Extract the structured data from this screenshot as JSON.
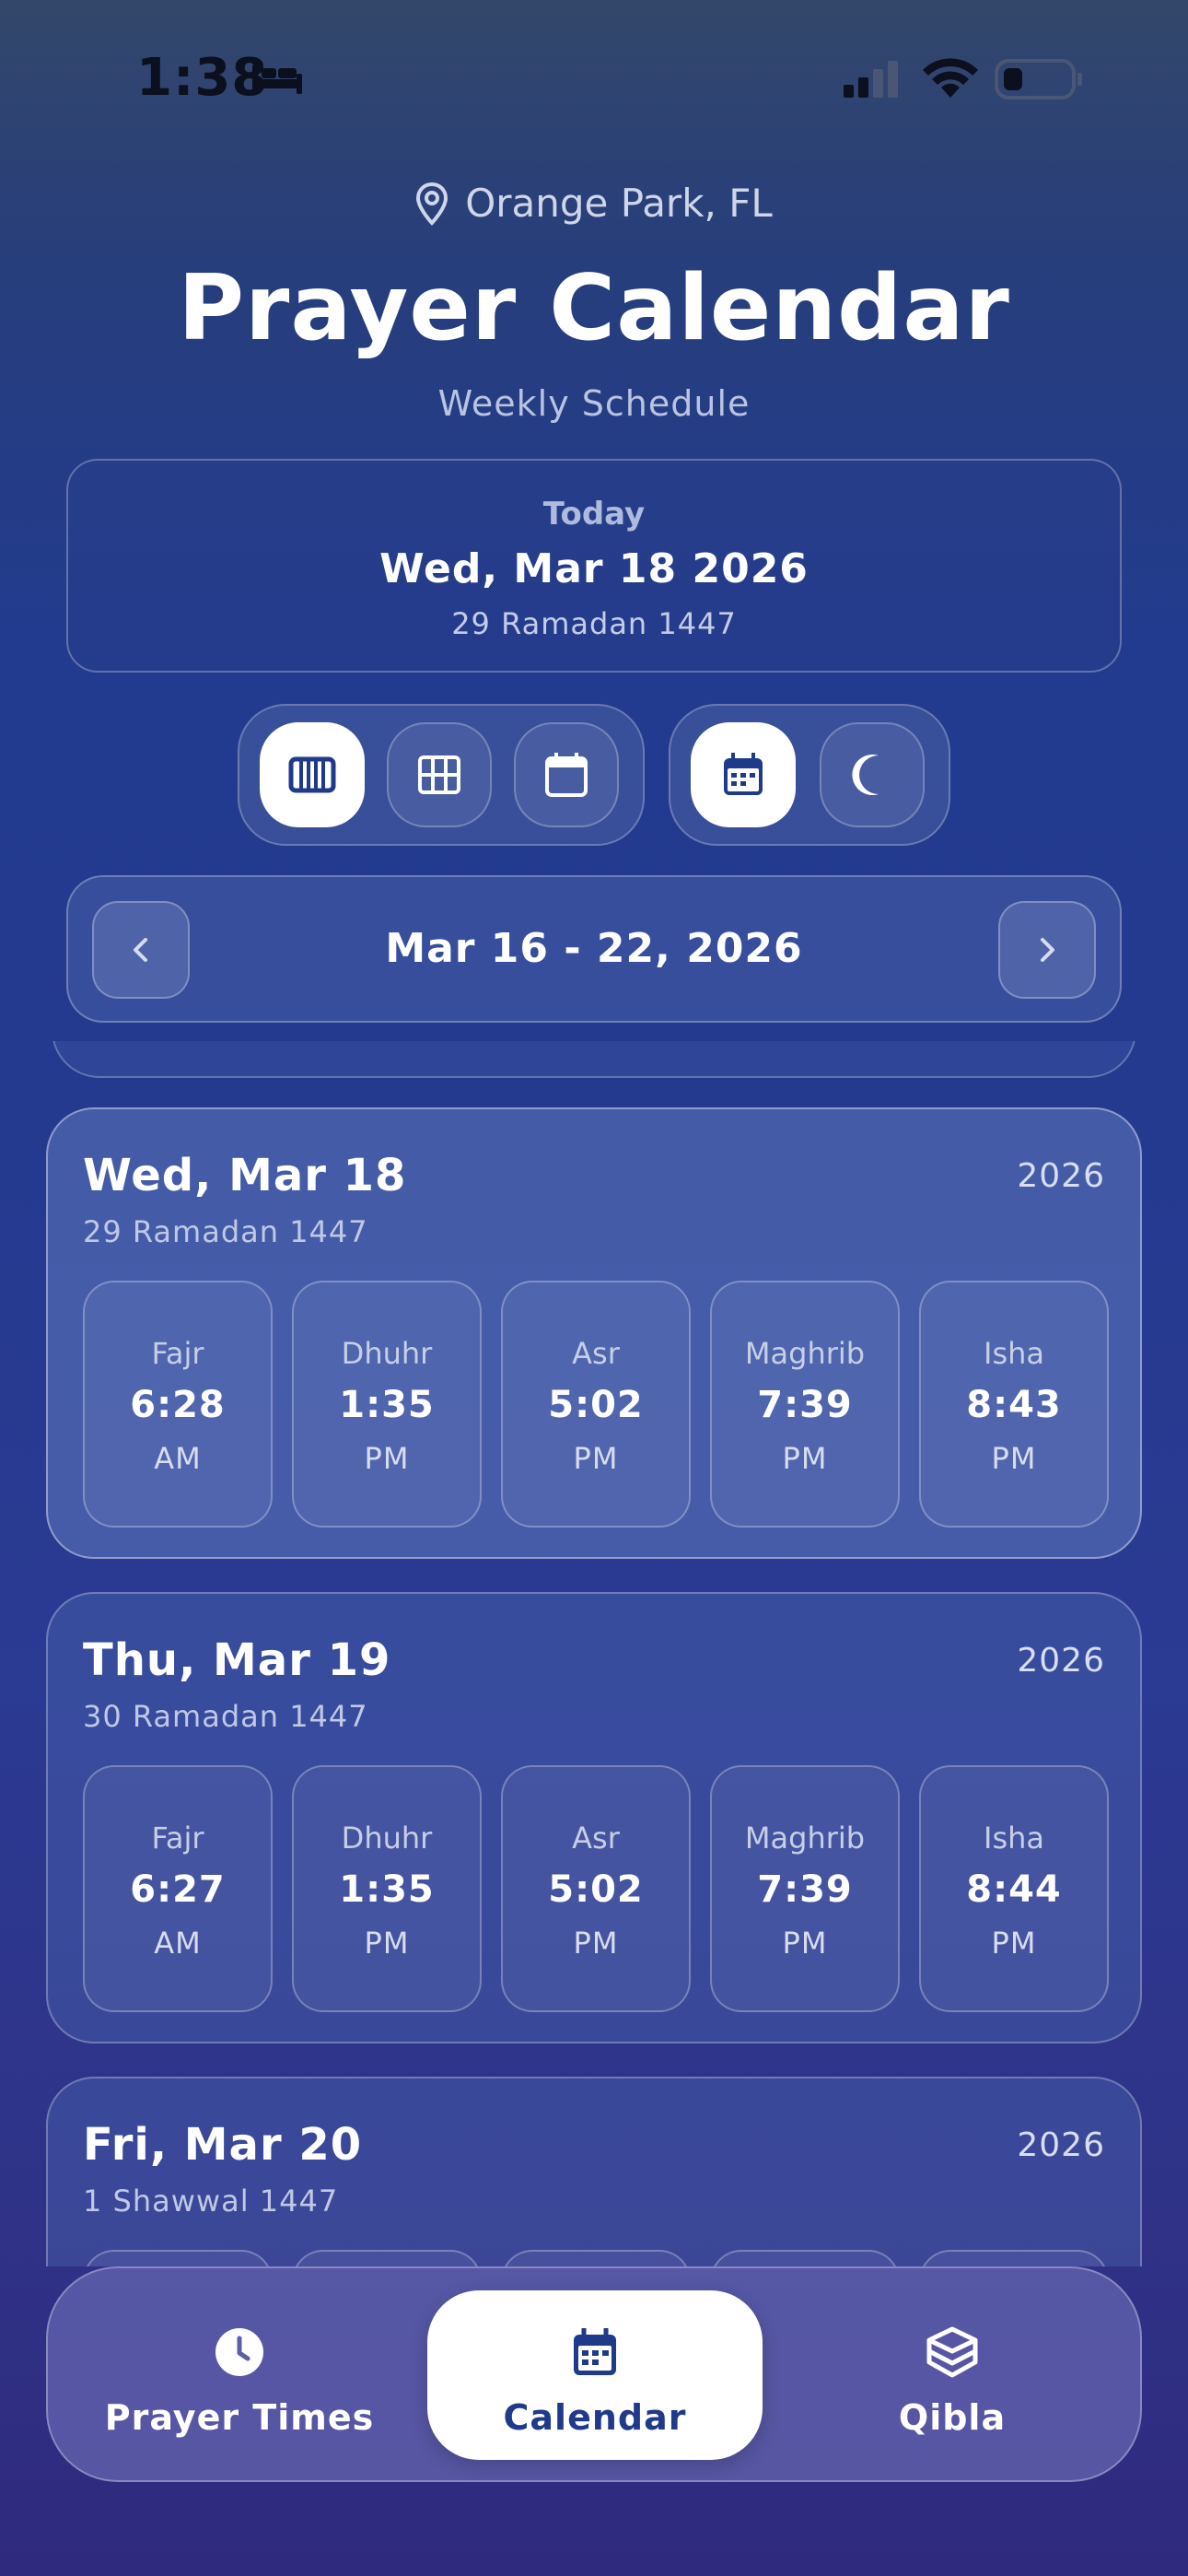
{
  "status_bar": {
    "time": "1:38"
  },
  "header": {
    "location": "Orange Park, FL",
    "title": "Prayer Calendar",
    "subtitle": "Weekly Schedule"
  },
  "today": {
    "label": "Today",
    "date": "Wed, Mar 18 2026",
    "hijri": "29 Ramadan 1447"
  },
  "view_toggles": [
    {
      "icon": "week-columns-icon",
      "active": true
    },
    {
      "icon": "grid-icon",
      "active": false
    },
    {
      "icon": "month-calendar-icon",
      "active": false
    }
  ],
  "calendar_toggles": [
    {
      "icon": "gregorian-calendar-icon",
      "active": true
    },
    {
      "icon": "crescent-moon-icon",
      "active": false
    }
  ],
  "week_nav": {
    "range": "Mar 16 - 22, 2026"
  },
  "days": [
    {
      "title": "Wed, Mar 18",
      "year": "2026",
      "hijri": "29 Ramadan 1447",
      "is_today": true,
      "prayers": [
        {
          "name": "Fajr",
          "time": "6:28",
          "period": "AM"
        },
        {
          "name": "Dhuhr",
          "time": "1:35",
          "period": "PM"
        },
        {
          "name": "Asr",
          "time": "5:02",
          "period": "PM"
        },
        {
          "name": "Maghrib",
          "time": "7:39",
          "period": "PM"
        },
        {
          "name": "Isha",
          "time": "8:43",
          "period": "PM"
        }
      ]
    },
    {
      "title": "Thu, Mar 19",
      "year": "2026",
      "hijri": "30 Ramadan 1447",
      "is_today": false,
      "prayers": [
        {
          "name": "Fajr",
          "time": "6:27",
          "period": "AM"
        },
        {
          "name": "Dhuhr",
          "time": "1:35",
          "period": "PM"
        },
        {
          "name": "Asr",
          "time": "5:02",
          "period": "PM"
        },
        {
          "name": "Maghrib",
          "time": "7:39",
          "period": "PM"
        },
        {
          "name": "Isha",
          "time": "8:44",
          "period": "PM"
        }
      ]
    },
    {
      "title": "Fri, Mar 20",
      "year": "2026",
      "hijri": "1 Shawwal 1447",
      "is_today": false,
      "prayers": []
    }
  ],
  "tabs": [
    {
      "label": "Prayer Times",
      "icon": "clock-icon",
      "active": false
    },
    {
      "label": "Calendar",
      "icon": "calendar-icon",
      "active": true
    },
    {
      "label": "Qibla",
      "icon": "kaaba-icon",
      "active": false
    }
  ],
  "colors": {
    "accent": "#1f3a8a",
    "active_bg": "#ffffff"
  }
}
